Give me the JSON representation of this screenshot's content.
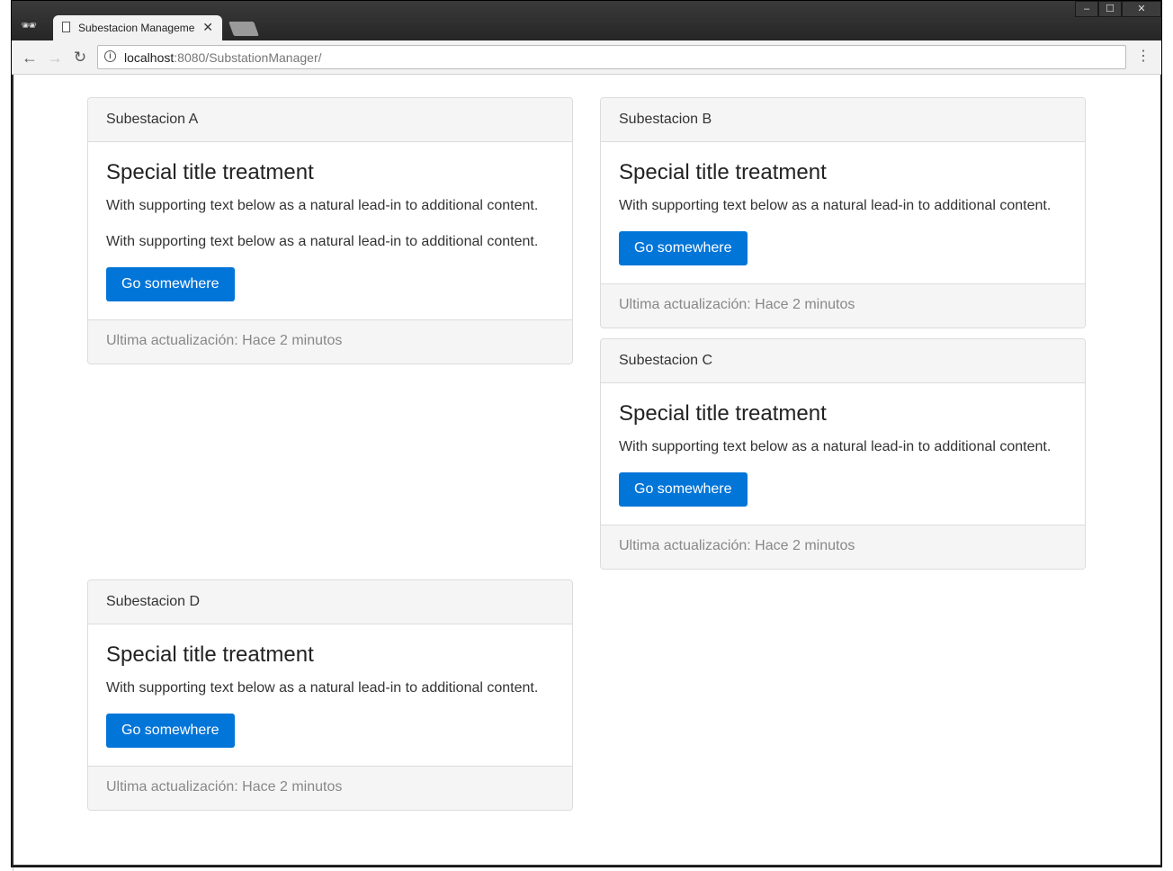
{
  "browser": {
    "tab_title": "Subestacion Managemen",
    "url_host": "localhost",
    "url_rest": ":8080/SubstationManager/",
    "icons": {
      "incognito": "incognito-icon",
      "back": "back-arrow-icon",
      "forward": "forward-arrow-icon",
      "reload": "reload-icon",
      "info": "info-icon",
      "menu": "kebab-menu-icon",
      "tab_close": "close-icon"
    }
  },
  "cards": [
    {
      "header": "Subestacion A",
      "title": "Special title treatment",
      "text_1": "With supporting text below as a natural lead-in to additional content.",
      "text_2": "With supporting text below as a natural lead-in to additional content.",
      "button": "Go somewhere",
      "footer": "Ultima actualización: Hace 2 minutos"
    },
    {
      "header": "Subestacion B",
      "title": "Special title treatment",
      "text_1": "With supporting text below as a natural lead-in to additional content.",
      "button": "Go somewhere",
      "footer": "Ultima actualización: Hace 2 minutos"
    },
    {
      "header": "Subestacion C",
      "title": "Special title treatment",
      "text_1": "With supporting text below as a natural lead-in to additional content.",
      "button": "Go somewhere",
      "footer": "Ultima actualización: Hace 2 minutos"
    },
    {
      "header": "Subestacion D",
      "title": "Special title treatment",
      "text_1": "With supporting text below as a natural lead-in to additional content.",
      "button": "Go somewhere",
      "footer": "Ultima actualización: Hace 2 minutos"
    }
  ],
  "colors": {
    "primary_button": "#0275d8",
    "card_header_bg": "#f5f5f5"
  }
}
